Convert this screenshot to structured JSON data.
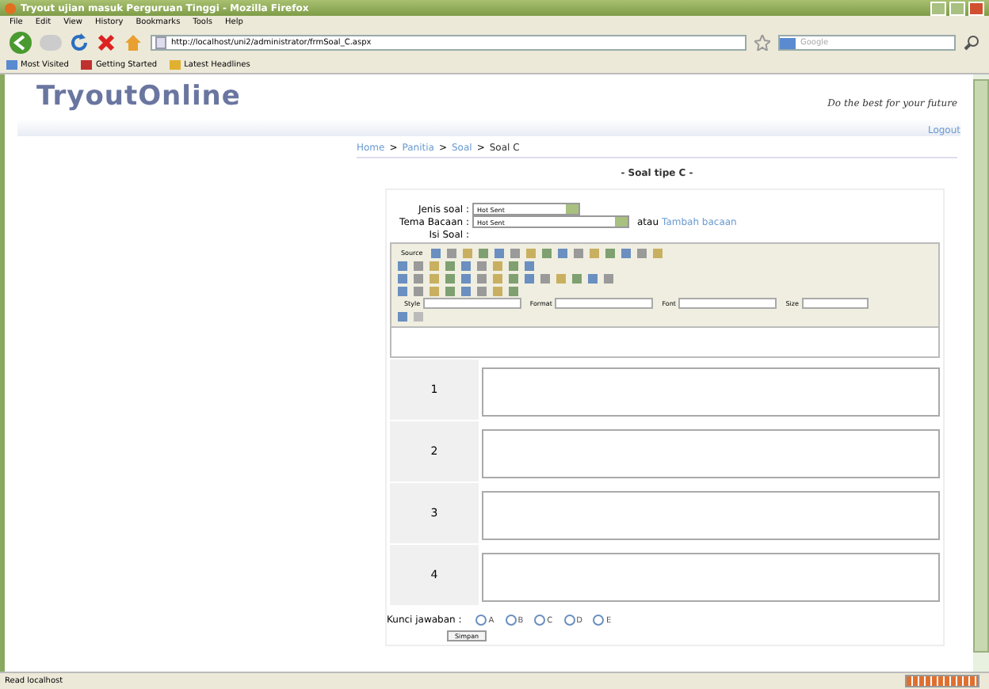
{
  "window": {
    "title": "Tryout ujian masuk Perguruan Tinggi - Mozilla Firefox"
  },
  "menu": [
    "File",
    "Edit",
    "View",
    "History",
    "Bookmarks",
    "Tools",
    "Help"
  ],
  "navigation": {
    "url": "http://localhost/uni2/administrator/frmSoal_C.aspx",
    "search_placeholder": "Google"
  },
  "bookmarks": [
    "Most Visited",
    "Getting Started",
    "Latest Headlines"
  ],
  "site": {
    "logo": "TryoutOnline",
    "tagline": "Do the best for your future",
    "logout": "Logout"
  },
  "breadcrumb": [
    {
      "label": "Home",
      "link": true
    },
    {
      "label": "Panitia",
      "link": true
    },
    {
      "label": "Soal",
      "link": true
    },
    {
      "label": "Soal C",
      "link": false
    }
  ],
  "breadcrumb_separator": ">",
  "heading": "- Soal tipe C -",
  "form": {
    "jenis_soal": {
      "label": "Jenis soal :",
      "value": "Hot Sent"
    },
    "tema_bacaan": {
      "label": "Tema Bacaan :",
      "value": "Hot Sent",
      "or": "atau",
      "link": "Tambah bacaan"
    },
    "isi_soal": {
      "label": "Isi Soal :"
    },
    "editor": {
      "source": "Source",
      "style": "Style",
      "format": "Format",
      "font": "Font",
      "size": "Size"
    },
    "answers": [
      "1",
      "2",
      "3",
      "4"
    ],
    "kunci": {
      "label": "Kunci jawaban :",
      "options": [
        {
          "label": "A",
          "selected": false
        },
        {
          "label": "B",
          "selected": false
        },
        {
          "label": "C",
          "selected": false
        },
        {
          "label": "D",
          "selected": false
        },
        {
          "label": "E",
          "selected": false
        }
      ]
    },
    "submit": "Simpan"
  },
  "status_bar": {
    "text": "Read localhost"
  }
}
